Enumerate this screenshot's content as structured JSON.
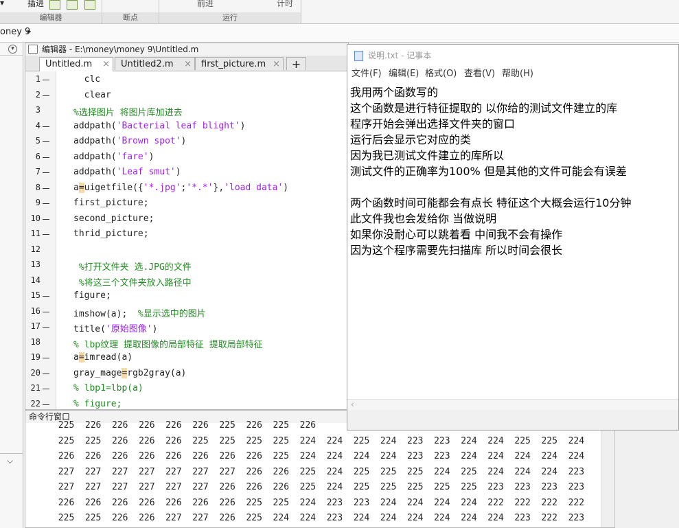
{
  "toolstrip": {
    "debug_btn_label": "插进",
    "forward_label": "前进",
    "timing_label": "计时",
    "groups": {
      "editor": "编辑器",
      "breakpoints": "断点",
      "run": "运行"
    }
  },
  "path": {
    "text": "oney 9",
    "sep": "▸"
  },
  "editor": {
    "title": "编辑器 - E:\\money\\money 9\\Untitled.m",
    "tabs": [
      {
        "label": "Untitled.m",
        "active": true
      },
      {
        "label": "Untitled2.m",
        "active": false
      },
      {
        "label": "first_picture.m",
        "active": false
      }
    ],
    "add_tab": "+",
    "close_glyph": "×",
    "lines": [
      {
        "n": "1",
        "dash": true,
        "code": "  clc"
      },
      {
        "n": "2",
        "dash": true,
        "code": "  clear"
      },
      {
        "n": "3",
        "dash": false,
        "code": "%选择图片 将图片库加进去"
      },
      {
        "n": "4",
        "dash": true,
        "code": "addpath('Bacterial leaf blight')"
      },
      {
        "n": "5",
        "dash": true,
        "code": "addpath('Brown spot')"
      },
      {
        "n": "6",
        "dash": true,
        "code": "addpath('fare')"
      },
      {
        "n": "7",
        "dash": true,
        "code": "addpath('Leaf smut')"
      },
      {
        "n": "8",
        "dash": true,
        "code": "a=uigetfile({'*.jpg';'*.*'},'load data')"
      },
      {
        "n": "9",
        "dash": true,
        "code": "first_picture;"
      },
      {
        "n": "10",
        "dash": true,
        "code": "second_picture;"
      },
      {
        "n": "11",
        "dash": true,
        "code": "thrid_picture;"
      },
      {
        "n": "12",
        "dash": false,
        "code": ""
      },
      {
        "n": "13",
        "dash": false,
        "code": " %打开文件夹 选.JPG的文件"
      },
      {
        "n": "14",
        "dash": false,
        "code": " %将这三个文件夹放入路径中"
      },
      {
        "n": "15",
        "dash": true,
        "code": "figure;"
      },
      {
        "n": "16",
        "dash": true,
        "code": "imshow(a);  %显示选中的图片"
      },
      {
        "n": "17",
        "dash": true,
        "code": "title('原始图像')"
      },
      {
        "n": "18",
        "dash": false,
        "code": "% lbp纹理 提取图像的局部特征 提取局部特征"
      },
      {
        "n": "19",
        "dash": true,
        "code": "a=imread(a)"
      },
      {
        "n": "20",
        "dash": true,
        "code": "gray_mage=rgb2gray(a)"
      },
      {
        "n": "21",
        "dash": true,
        "code": "% lbp1=lbp(a)"
      },
      {
        "n": "22",
        "dash": true,
        "code": "% figure;"
      }
    ]
  },
  "command_window": {
    "title": "命令行窗口",
    "rows": [
      [
        "225",
        "226",
        "226",
        "226",
        "226",
        "226",
        "225",
        "226",
        "225",
        "226"
      ],
      [
        "225",
        "225",
        "226",
        "226",
        "226",
        "225",
        "225",
        "225",
        "225",
        "224",
        "224",
        "225",
        "224",
        "223",
        "223",
        "224",
        "224",
        "225",
        "225",
        "224"
      ],
      [
        "226",
        "226",
        "226",
        "226",
        "226",
        "226",
        "226",
        "226",
        "225",
        "224",
        "224",
        "224",
        "224",
        "223",
        "223",
        "224",
        "224",
        "224",
        "224",
        "224"
      ],
      [
        "227",
        "227",
        "227",
        "227",
        "227",
        "227",
        "227",
        "226",
        "226",
        "225",
        "224",
        "225",
        "225",
        "225",
        "224",
        "225",
        "224",
        "224",
        "224",
        "223"
      ],
      [
        "227",
        "227",
        "227",
        "227",
        "227",
        "227",
        "226",
        "226",
        "226",
        "225",
        "224",
        "225",
        "225",
        "225",
        "225",
        "225",
        "223",
        "223",
        "223",
        "223"
      ],
      [
        "226",
        "226",
        "226",
        "226",
        "226",
        "226",
        "226",
        "225",
        "225",
        "224",
        "223",
        "223",
        "224",
        "224",
        "224",
        "224",
        "222",
        "222",
        "222",
        "222"
      ],
      [
        "225",
        "225",
        "226",
        "226",
        "227",
        "227",
        "226",
        "225",
        "224",
        "224",
        "223",
        "224",
        "224",
        "224",
        "224",
        "224",
        "224",
        "223",
        "222",
        "223"
      ]
    ]
  },
  "notepad": {
    "title": "说明.txt - 记事本",
    "menu": [
      "文件(F)",
      "编辑(E)",
      "格式(O)",
      "查看(V)",
      "帮助(H)"
    ],
    "lines": [
      "我用两个函数写的",
      "这个函数是进行特征提取的  以你给的测试文件建立的库",
      "程序开始会弹出选择文件夹的窗口",
      "运行后会显示它对应的类",
      "因为我已测试文件建立的库所以",
      "测试文件的正确率为100% 但是其他的文件可能会有误差",
      "",
      "两个函数时间可能都会有点长 特征这个大概会运行10分钟",
      "此文件我也会发给你 当做说明",
      "如果你没耐心可以跳着看 中间我不会有操作",
      "因为这个程序需要先扫描库 所以时间会很长"
    ]
  }
}
